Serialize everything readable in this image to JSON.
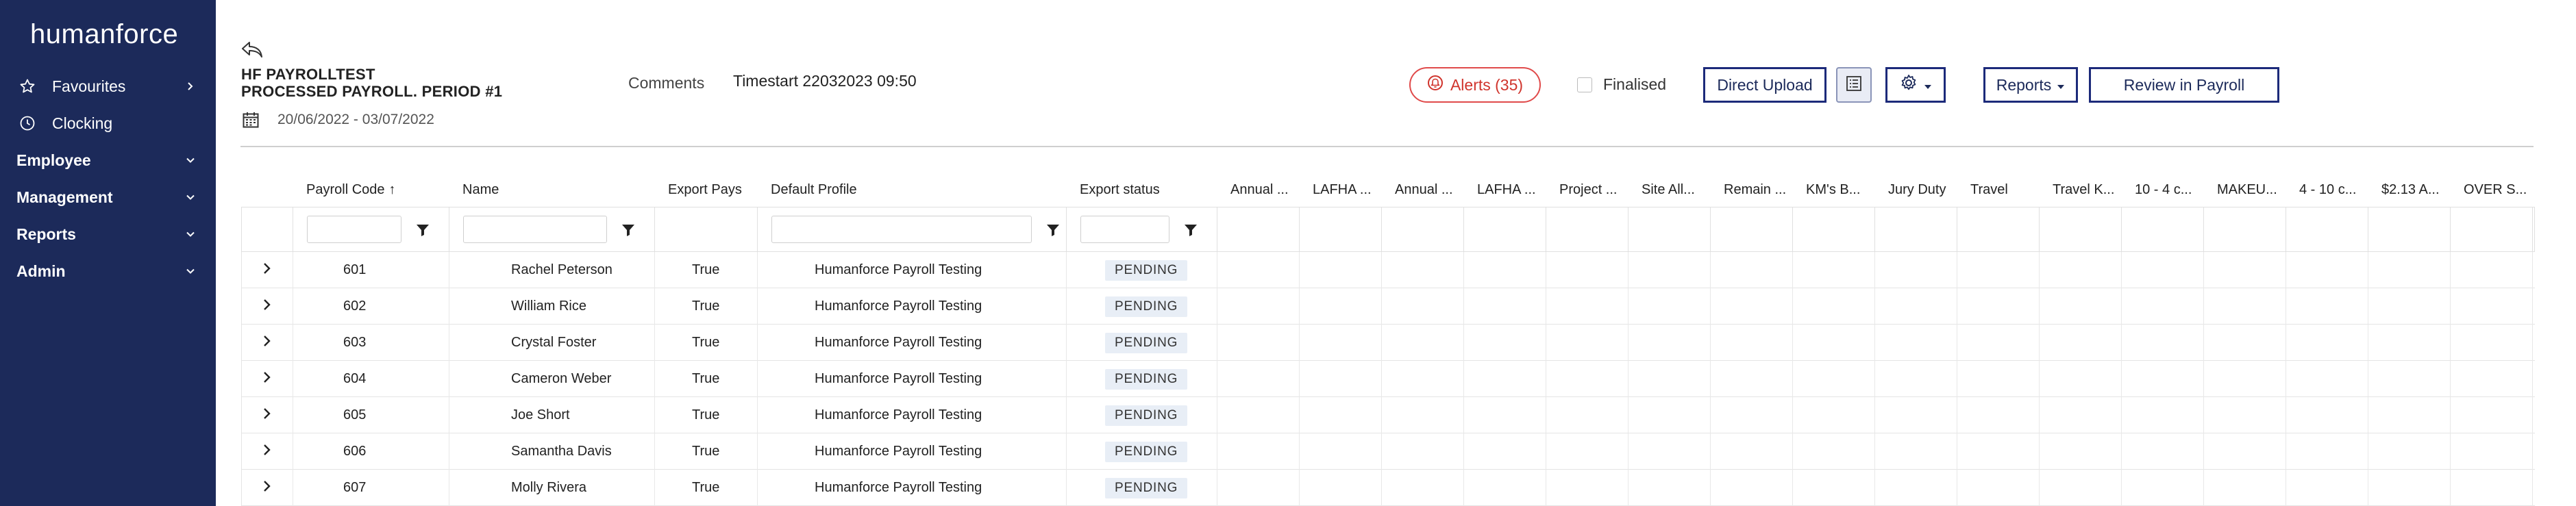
{
  "app": {
    "logo_text": "humanforce"
  },
  "sidebar": {
    "items": [
      {
        "label": "Favourites",
        "icon": "star-icon"
      },
      {
        "label": "Clocking",
        "icon": "clock-icon"
      },
      {
        "label": "Employee"
      },
      {
        "label": "Management"
      },
      {
        "label": "Reports"
      },
      {
        "label": "Admin"
      }
    ]
  },
  "page": {
    "title_line1": "HF PAYROLLTEST",
    "title_line2": "PROCESSED PAYROLL. PERIOD #1",
    "date_range": "20/06/2022 - 03/07/2022",
    "comments_label": "Comments",
    "timestart": "Timestart 22032023 09:50"
  },
  "toolbar": {
    "alerts_label": "Alerts (35)",
    "finalised_label": "Finalised",
    "finalised_checked": false,
    "direct_upload_label": "Direct Upload",
    "reports_label": "Reports",
    "review_label": "Review in Payroll"
  },
  "colors": {
    "sidebar": "#1c2a5a",
    "alert": "#d0342c",
    "button_border": "#1c2a7a"
  },
  "table": {
    "columns": [
      "Payroll Code",
      "Name",
      "Export Pays",
      "Default Profile",
      "Export status",
      "Annual ...",
      "LAFHA ...",
      "Annual ...",
      "LAFHA ...",
      "Project ...",
      "Site All...",
      "Remain ...",
      "KM's B...",
      "Jury Duty",
      "Travel",
      "Travel K...",
      "10 - 4 c...",
      "MAKEU...",
      "4 - 10 c...",
      "$2.13 A...",
      "OVER S..."
    ],
    "sort_indicator": "↑",
    "rows": [
      {
        "code": "601",
        "name": "Rachel Peterson",
        "export_pays": "True",
        "profile": "Humanforce Payroll Testing",
        "status": "PENDING"
      },
      {
        "code": "602",
        "name": "William Rice",
        "export_pays": "True",
        "profile": "Humanforce Payroll Testing",
        "status": "PENDING"
      },
      {
        "code": "603",
        "name": "Crystal Foster",
        "export_pays": "True",
        "profile": "Humanforce Payroll Testing",
        "status": "PENDING"
      },
      {
        "code": "604",
        "name": "Cameron Weber",
        "export_pays": "True",
        "profile": "Humanforce Payroll Testing",
        "status": "PENDING"
      },
      {
        "code": "605",
        "name": "Joe Short",
        "export_pays": "True",
        "profile": "Humanforce Payroll Testing",
        "status": "PENDING"
      },
      {
        "code": "606",
        "name": "Samantha Davis",
        "export_pays": "True",
        "profile": "Humanforce Payroll Testing",
        "status": "PENDING"
      },
      {
        "code": "607",
        "name": "Molly Rivera",
        "export_pays": "True",
        "profile": "Humanforce Payroll Testing",
        "status": "PENDING"
      }
    ]
  }
}
